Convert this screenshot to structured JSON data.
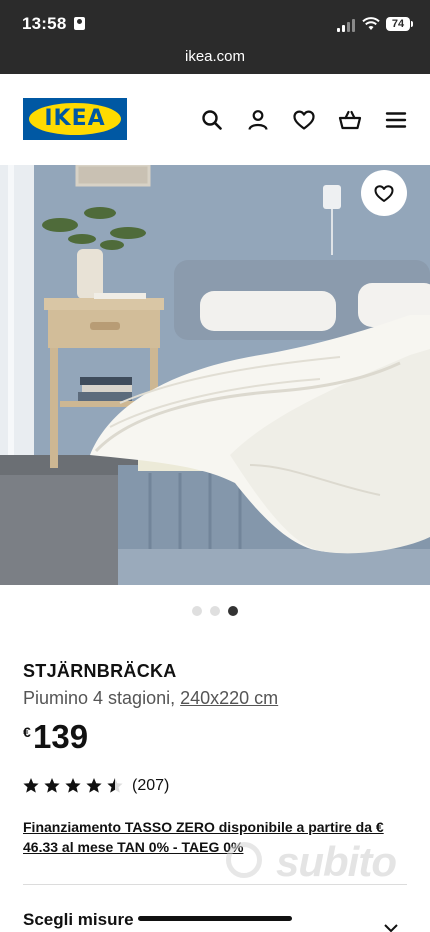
{
  "status_bar": {
    "time": "13:58",
    "battery": "74",
    "icons": [
      "person-badge-icon",
      "signal-icon",
      "wifi-icon",
      "battery-icon"
    ]
  },
  "browser": {
    "url": "ikea.com"
  },
  "header": {
    "logo_text": "IKEA",
    "icons": [
      "search-icon",
      "account-icon",
      "wishlist-heart-icon",
      "shopping-basket-icon",
      "menu-icon"
    ]
  },
  "colors": {
    "ikea_blue": "#0058a3",
    "ikea_yellow": "#ffdb00",
    "status_bar_bg": "#2b2b2b",
    "star_color": "#111111"
  },
  "gallery": {
    "image": "bedroom-duvet-photo",
    "total_images": 3,
    "active_index": 3,
    "favorite_icon": "heart-outline-icon"
  },
  "product": {
    "name": "STJÄRNBRÄCKA",
    "description": "Piumino 4 stagioni,",
    "size": "240x220 cm",
    "currency": "€",
    "price": "139",
    "rating": 4.5,
    "rating_max": 5,
    "review_count": "(207)",
    "financing": "Finanziamento TASSO ZERO disponibile a partire da € 46.33 al mese TAN 0% - TAEG 0%"
  },
  "options": {
    "sizes_label": "Scegli misure"
  },
  "watermark": {
    "text": "subito"
  }
}
